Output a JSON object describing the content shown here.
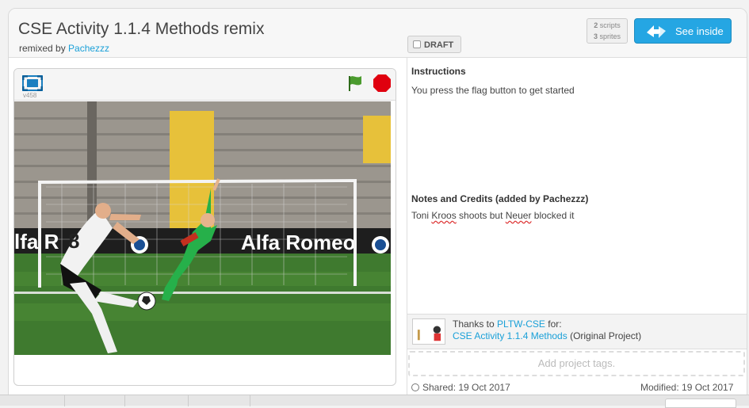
{
  "project": {
    "title": "CSE Activity 1.1.4 Methods remix",
    "remixed_prefix": "remixed by",
    "remixer": "Pachezzz"
  },
  "draft_label": "DRAFT",
  "stats": {
    "scripts_count": "2",
    "scripts_label": "scripts",
    "sprites_count": "3",
    "sprites_label": "sprites"
  },
  "see_inside_label": "See inside",
  "player": {
    "version": "v458"
  },
  "stage": {
    "banner_text": "Alfa Romeo",
    "banner_text_left": "lfa R",
    "jersey_number": "8"
  },
  "instructions": {
    "heading": "Instructions",
    "text": "You press the flag button to get started"
  },
  "notes": {
    "heading": "Notes and Credits (added by Pachezzz)",
    "text_pre": "Toni ",
    "word1": "Kroos",
    "text_mid": " shoots but ",
    "word2": "Neuer",
    "text_post": " blocked it"
  },
  "credits": {
    "thanks_prefix": "Thanks to ",
    "author": "PLTW-CSE",
    "for_label": " for:",
    "original_title": "CSE Activity 1.1.4 Methods",
    "original_suffix": " (Original Project)"
  },
  "tags_placeholder": "Add project tags.",
  "shared": "Shared: 19 Oct 2017",
  "modified": "Modified: 19 Oct 2017",
  "colors": {
    "accent": "#25a6e3",
    "link": "#1aa0d8",
    "flag": "#4b9b2e",
    "stop": "#e0000f"
  }
}
